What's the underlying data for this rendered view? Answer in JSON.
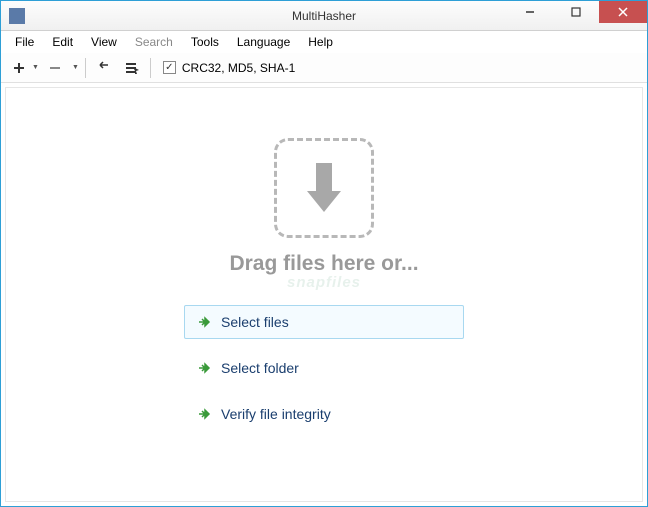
{
  "window": {
    "title": "MultiHasher"
  },
  "menu": {
    "file": "File",
    "edit": "Edit",
    "view": "View",
    "search": "Search",
    "tools": "Tools",
    "language": "Language",
    "help": "Help"
  },
  "toolbar": {
    "hash_checkbox_checked": true,
    "hash_label": "CRC32, MD5, SHA-1"
  },
  "dropzone": {
    "drag_text": "Drag files here or...",
    "watermark": "snapfiles"
  },
  "actions": {
    "select_files": "Select files",
    "select_folder": "Select folder",
    "verify_integrity": "Verify file integrity"
  }
}
